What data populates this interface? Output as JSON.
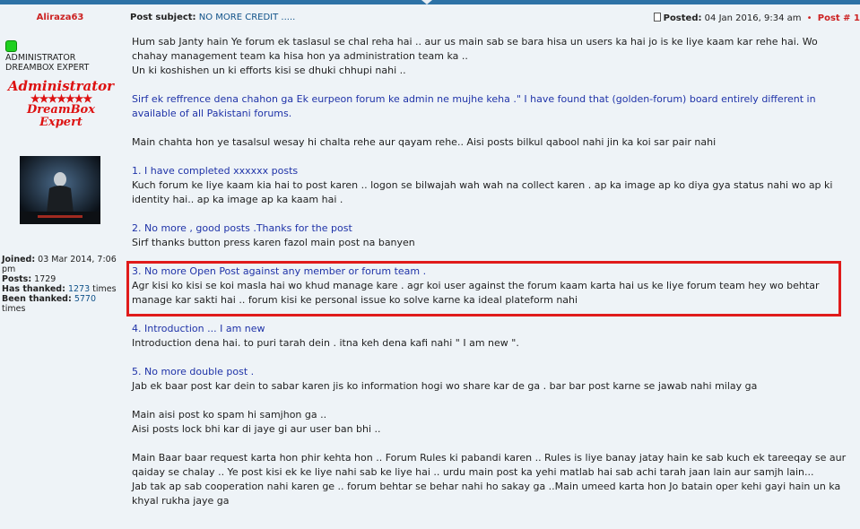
{
  "author": {
    "username": "Aliraza63",
    "rank_lines": [
      "ADMINISTRATOR",
      "DREAMBOX EXPERT"
    ],
    "rank_image": {
      "line1": "Administrator",
      "stars": "★★★★★★★",
      "line2": "DreamBox Expert"
    },
    "stats": {
      "joined_label": "Joined:",
      "joined_value": "03 Mar 2014, 7:06 pm",
      "posts_label": "Posts:",
      "posts_value": "1729",
      "thanked_label": "Has thanked:",
      "thanked_value": "1273",
      "thanked_suffix": "times",
      "been_thanked_label": "Been thanked:",
      "been_thanked_value": "5770",
      "been_thanked_suffix": "times"
    }
  },
  "post": {
    "subject_label": "Post subject:",
    "subject": "NO MORE CREDIT .....",
    "posted_label": "Posted:",
    "posted_value": "04 Jan 2016, 9:34 am",
    "post_number": "Post # 1"
  },
  "body": {
    "p1": [
      "Hum sab Janty hain Ye forum ek taslasul se chal reha hai .. aur us main sab se bara hisa un users ka hai jo is ke liye kaam kar rehe hai. Wo chahay management team ka hisa hon ya administration team ka ..",
      "Un ki koshishen un ki efforts kisi se dhuki chhupi nahi .."
    ],
    "p2": "Sirf ek reffrence dena chahon ga Ek eurpeon forum ke admin ne mujhe keha .\" I have found that (golden-forum) board entirely different in available of all Pakistani forums.",
    "p3": "Main chahta hon ye tasalsul wesay hi chalta rehe aur qayam rehe.. Aisi posts bilkul qabool nahi jin ka koi sar pair nahi",
    "r1_title": "1. I have completed xxxxxx posts",
    "r1_text": "Kuch forum ke liye kaam kia hai to post karen .. logon se bilwajah wah wah na collect karen . ap ka image ap ko diya gya status nahi wo ap ki identity hai.. ap ka image ap ka kaam hai .",
    "r2_title": "2. No more , good posts .Thanks for the post",
    "r2_text": "Sirf thanks button press karen fazol main post na banyen",
    "r3_title": "3. No more Open Post against any member or forum team .",
    "r3_text": "Agr kisi ko kisi se koi masla hai wo khud manage kare . agr koi user against the forum kaam karta hai us ke liye forum team hey wo behtar manage kar sakti hai .. forum kisi ke personal issue ko solve karne ka ideal plateform nahi",
    "r4_title": "4. Introduction ... I am new",
    "r4_text": "Introduction dena hai. to puri tarah dein . itna keh dena kafi nahi \" I am new \".",
    "r5_title": "5. No more double post .",
    "r5_text": "Jab ek baar post kar dein to sabar karen jis ko information hogi wo share kar de ga . bar bar post karne se jawab nahi milay ga",
    "p4": [
      "Main aisi post ko spam hi samjhon ga ..",
      "Aisi posts lock bhi kar di jaye gi aur user ban bhi .."
    ],
    "p5": [
      "Main Baar baar request karta hon phir kehta hon .. Forum Rules ki pabandi karen .. Rules is liye banay jatay hain ke sab kuch ek tareeqay se aur qaiday se chalay .. Ye post kisi ek ke liye nahi sab ke liye hai .. urdu main post ka yehi matlab hai sab achi tarah jaan lain aur samjh lain...",
      "Jab tak ap sab cooperation nahi karen ge .. forum behtar se behar nahi ho sakay ga ..Main umeed karta hon Jo batain oper kehi gayi hain un ka khyal rukha jaye ga"
    ]
  },
  "colors": {
    "topbar": "#2d72a6",
    "link": "#105289",
    "highlight": "#e01b1b",
    "username": "#cc2222"
  }
}
